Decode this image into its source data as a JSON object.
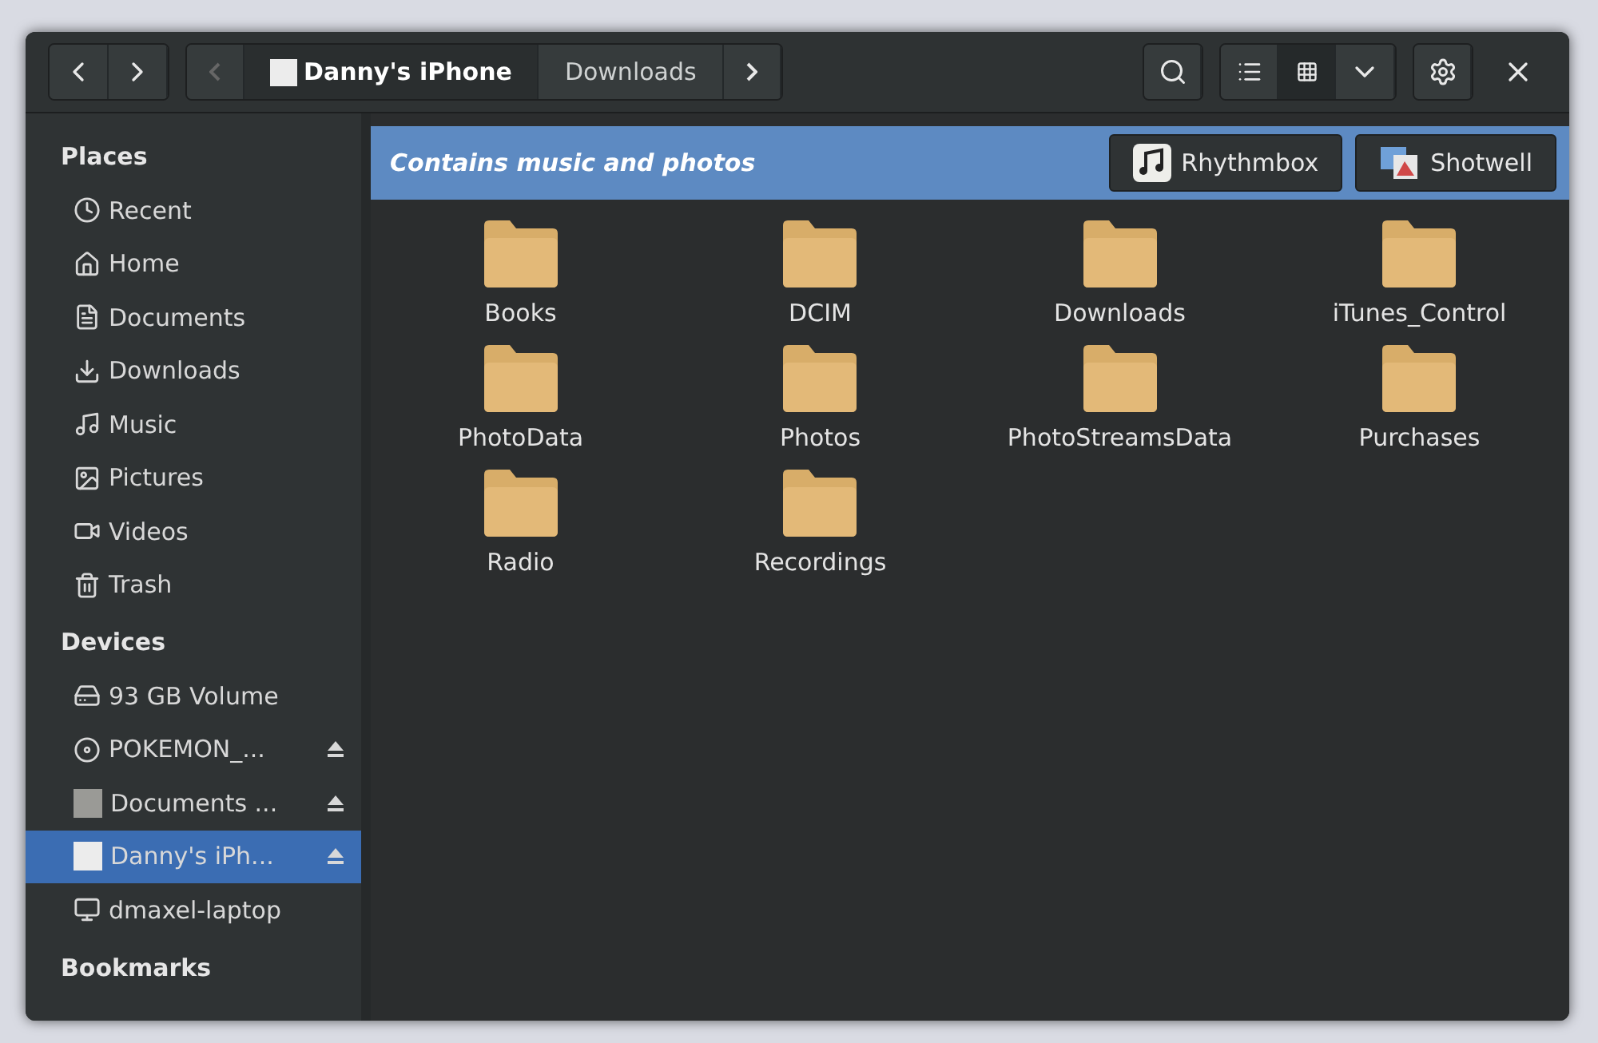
{
  "toolbar": {
    "path": [
      {
        "label": "Danny's iPhone",
        "kind": "device",
        "selected": true
      },
      {
        "label": "Downloads",
        "kind": "folder",
        "selected": false
      }
    ],
    "views": [
      {
        "kind": "list",
        "selected": false
      },
      {
        "kind": "grid",
        "selected": true
      }
    ]
  },
  "sidebar": {
    "sections": [
      {
        "title": "Places",
        "items": [
          {
            "label": "Recent",
            "kind": "recent",
            "selected": false,
            "ejectable": false
          },
          {
            "label": "Home",
            "kind": "home",
            "selected": false,
            "ejectable": false
          },
          {
            "label": "Documents",
            "kind": "documents",
            "selected": false,
            "ejectable": false
          },
          {
            "label": "Downloads",
            "kind": "downloads",
            "selected": false,
            "ejectable": false
          },
          {
            "label": "Music",
            "kind": "music",
            "selected": false,
            "ejectable": false
          },
          {
            "label": "Pictures",
            "kind": "pictures",
            "selected": false,
            "ejectable": false
          },
          {
            "label": "Videos",
            "kind": "videos",
            "selected": false,
            "ejectable": false
          },
          {
            "label": "Trash",
            "kind": "trash",
            "selected": false,
            "ejectable": false
          }
        ]
      },
      {
        "title": "Devices",
        "items": [
          {
            "label": "93 GB Volume",
            "kind": "drive",
            "selected": false,
            "ejectable": false
          },
          {
            "label": "POKEMON_...",
            "kind": "disc",
            "selected": false,
            "ejectable": true
          },
          {
            "label": "Documents ...",
            "kind": "volume",
            "selected": false,
            "ejectable": true
          },
          {
            "label": "Danny's iPh...",
            "kind": "phone",
            "selected": true,
            "ejectable": true
          },
          {
            "label": "dmaxel-laptop",
            "kind": "computer",
            "selected": false,
            "ejectable": false
          }
        ]
      },
      {
        "title": "Bookmarks"
      }
    ]
  },
  "info_bar": {
    "text": "Contains music and photos",
    "apps": [
      {
        "label": "Rhythmbox",
        "kind": "music"
      },
      {
        "label": "Shotwell",
        "kind": "photos"
      }
    ]
  },
  "folders": [
    "Books",
    "DCIM",
    "Downloads",
    "iTunes_Control",
    "PhotoData",
    "Photos",
    "PhotoStreamsData",
    "Purchases",
    "Radio",
    "Recordings"
  ]
}
